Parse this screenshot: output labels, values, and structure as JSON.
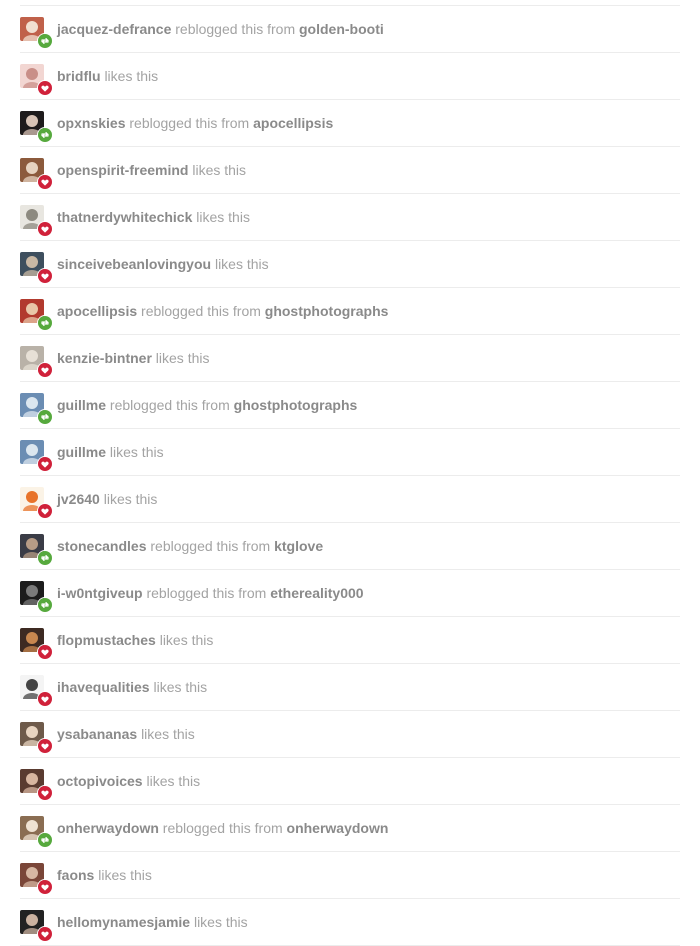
{
  "colors": {
    "like": "#d0213a",
    "reblog": "#56a93d",
    "separator": "#ececec",
    "blog_name": "#8a8a8a",
    "action_text": "#a3a3a3"
  },
  "notes": [
    {
      "type": "reblog",
      "blog": "jacquez-defrance",
      "action": "reblogged this from",
      "source": "golden-booti",
      "avatar": [
        "#c0614a",
        "#f1dfd0"
      ]
    },
    {
      "type": "like",
      "blog": "bridflu",
      "action": "likes this",
      "avatar": [
        "#f2d6d2",
        "#c98f88"
      ]
    },
    {
      "type": "reblog",
      "blog": "opxnskies",
      "action": "reblogged this from",
      "source": "apocellipsis",
      "avatar": [
        "#1e1b1c",
        "#d8c3b6"
      ]
    },
    {
      "type": "like",
      "blog": "openspirit-freemind",
      "action": "likes this",
      "avatar": [
        "#8c5a3c",
        "#e7d3c0"
      ]
    },
    {
      "type": "like",
      "blog": "thatnerdywhitechick",
      "action": "likes this",
      "avatar": [
        "#e8e6e0",
        "#8d8a80"
      ]
    },
    {
      "type": "like",
      "blog": "sinceivebeanlovingyou",
      "action": "likes this",
      "avatar": [
        "#3e4f5e",
        "#c9b8a4"
      ]
    },
    {
      "type": "reblog",
      "blog": "apocellipsis",
      "action": "reblogged this from",
      "source": "ghostphotographs",
      "avatar": [
        "#b23a2e",
        "#e9c7a8"
      ]
    },
    {
      "type": "like",
      "blog": "kenzie-bintner",
      "action": "likes this",
      "avatar": [
        "#b9b2a8",
        "#e7e0d6"
      ]
    },
    {
      "type": "reblog",
      "blog": "guillme",
      "action": "reblogged this from",
      "source": "ghostphotographs",
      "avatar": [
        "#6b8db3",
        "#dbe6ef"
      ]
    },
    {
      "type": "like",
      "blog": "guillme",
      "action": "likes this",
      "avatar": [
        "#6b8db3",
        "#dbe6ef"
      ]
    },
    {
      "type": "like",
      "blog": "jv2640",
      "action": "likes this",
      "avatar": [
        "#fbf3e6",
        "#e8732a"
      ]
    },
    {
      "type": "reblog",
      "blog": "stonecandles",
      "action": "reblogged this from",
      "source": "ktglove",
      "avatar": [
        "#3a3c46",
        "#b79c86"
      ]
    },
    {
      "type": "reblog",
      "blog": "i-w0ntgiveup",
      "action": "reblogged this from",
      "source": "ethereality000",
      "avatar": [
        "#1c1c1c",
        "#7a7a7a"
      ]
    },
    {
      "type": "like",
      "blog": "flopmustaches",
      "action": "likes this",
      "avatar": [
        "#3d2a22",
        "#c8874f"
      ]
    },
    {
      "type": "like",
      "blog": "ihavequalities",
      "action": "likes this",
      "avatar": [
        "#f4f4f4",
        "#444444"
      ]
    },
    {
      "type": "like",
      "blog": "ysabananas",
      "action": "likes this",
      "avatar": [
        "#6e5a4a",
        "#e8d4c0"
      ]
    },
    {
      "type": "like",
      "blog": "octopivoices",
      "action": "likes this",
      "avatar": [
        "#5a3b30",
        "#d8b6a0"
      ]
    },
    {
      "type": "reblog",
      "blog": "onherwaydown",
      "action": "reblogged this from",
      "source": "onherwaydown",
      "avatar": [
        "#8a6d52",
        "#efe2d2"
      ]
    },
    {
      "type": "like",
      "blog": "faons",
      "action": "likes this",
      "avatar": [
        "#7a4638",
        "#d7b7a2"
      ]
    },
    {
      "type": "like",
      "blog": "hellomynamesjamie",
      "action": "likes this",
      "avatar": [
        "#222222",
        "#cbb2a0"
      ]
    }
  ]
}
